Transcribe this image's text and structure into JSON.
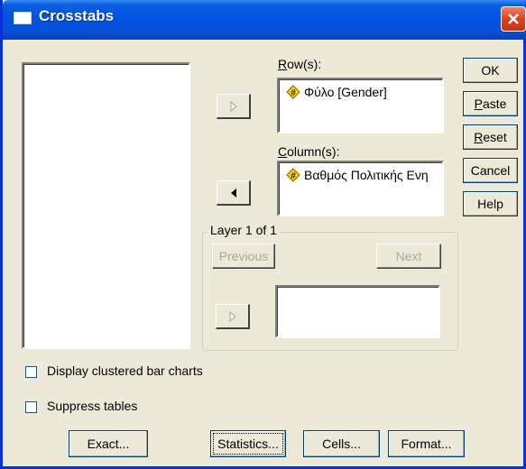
{
  "window": {
    "title": "Crosstabs"
  },
  "rows": {
    "label": "Row(s):",
    "items": [
      "Φύλο [Gender]"
    ]
  },
  "columns": {
    "label": "Column(s):",
    "items": [
      "Βαθμός Πολιτικής Ενη"
    ]
  },
  "layer": {
    "label": "Layer 1 of 1",
    "previous": "Previous",
    "next": "Next"
  },
  "side_buttons": {
    "ok": "OK",
    "paste": "Paste",
    "reset": "Reset",
    "cancel": "Cancel",
    "help": "Help"
  },
  "options": {
    "clustered": "Display clustered bar charts",
    "suppress": "Suppress tables"
  },
  "bottom_buttons": {
    "exact": "Exact...",
    "statistics": "Statistics...",
    "cells": "Cells...",
    "format": "Format..."
  },
  "icons": {
    "variable": "ordinal-variable-icon",
    "move_right": "arrow-right-icon",
    "move_left": "arrow-left-icon",
    "close": "close-icon"
  }
}
